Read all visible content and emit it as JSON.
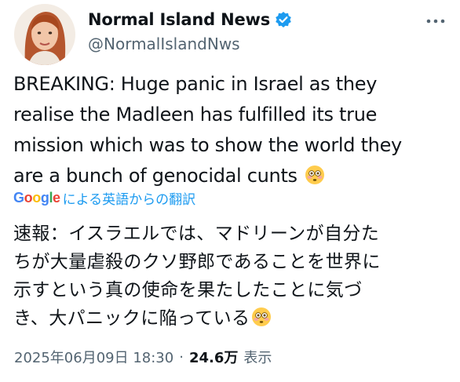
{
  "author": {
    "display_name": "Normal Island News",
    "handle": "@NormalIslandNws",
    "avatar_icon": "woman-portrait-avatar",
    "verified_icon": "verified-badge-icon"
  },
  "tweet": {
    "text": "BREAKING: Huge panic in Israel as they\nrealise the Madleen has fulfilled its true\nmission which was to show the world they\nare a bunch of genocidal cunts",
    "emoji_icon": "flushed-face-emoji"
  },
  "translation": {
    "logo": "Google",
    "label": "による英語からの翻訳",
    "text": "速報：イスラエルでは、マドリーンが自分た\nちが大量虐殺のクソ野郎であることを世界に\n示すという真の使命を果たしたことに気づ\nき、大パニックに陥っている"
  },
  "meta": {
    "timestamp": "2025年06月09日 18:30",
    "separator": "·",
    "views_count": "24.6万",
    "views_label": "表示"
  },
  "colors": {
    "text": "#0f1419",
    "secondary": "#536471",
    "link": "#1d9bf0",
    "verified": "#1d9bf0"
  }
}
